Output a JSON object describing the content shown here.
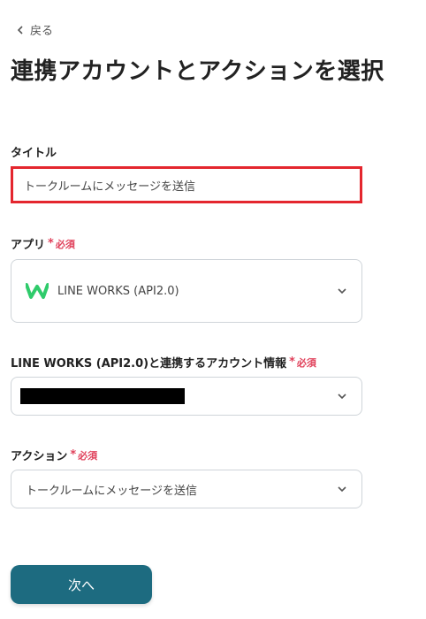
{
  "back": {
    "label": "戻る"
  },
  "page": {
    "title": "連携アカウントとアクションを選択"
  },
  "title_field": {
    "label": "タイトル",
    "value": "トークルームにメッセージを送信"
  },
  "app_field": {
    "label": "アプリ",
    "required": "必須",
    "selected": "LINE WORKS (API2.0)",
    "logo_color": "#2fcb6b"
  },
  "account_field": {
    "label": "LINE WORKS (API2.0)と連携するアカウント情報",
    "required": "必須"
  },
  "action_field": {
    "label": "アクション",
    "required": "必須",
    "selected": "トークルームにメッセージを送信"
  },
  "next_button": {
    "label": "次へ"
  },
  "colors": {
    "accent": "#1d6b80",
    "required": "#e0405a",
    "highlight_border": "#e4262e"
  }
}
